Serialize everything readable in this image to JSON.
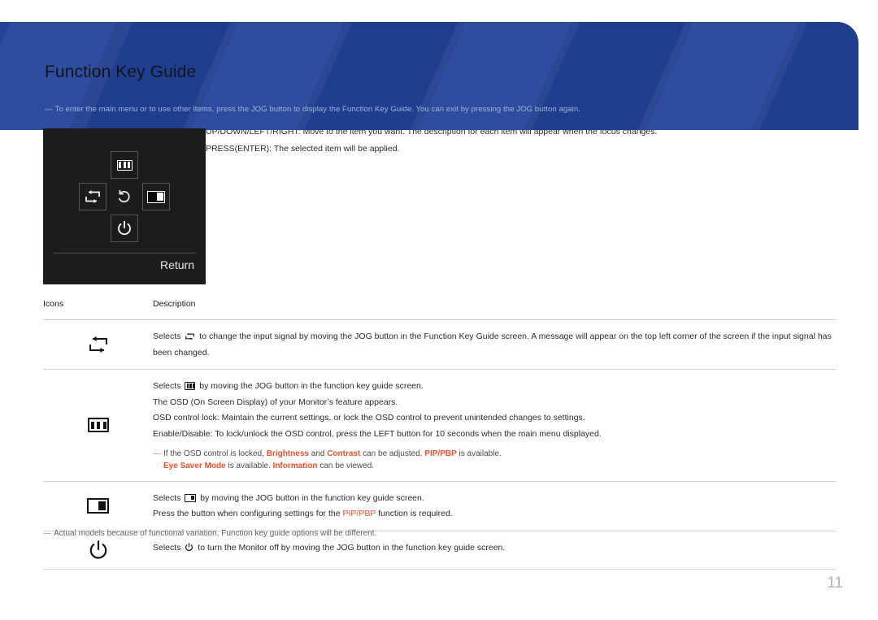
{
  "header": {
    "title": "Function Key Guide",
    "note_dash": "—",
    "note": "To enter the main menu or to use other items, press the JOG button to display the Function Key Guide. You can exit by pressing the JOG button again.",
    "background_color": "#23439b"
  },
  "intro": {
    "line1": "UP/DOWN/LEFT/RIGHT: Move to the item you want. The description for each item will appear when the focus changes.",
    "line2": "PRESS(ENTER): The selected item will be applied."
  },
  "osd": {
    "return_label": "Return",
    "buttons": {
      "up": "menu-icon",
      "left": "source-icon",
      "center": "back-icon",
      "right": "pip-pbp-icon",
      "down": "power-icon"
    }
  },
  "table": {
    "headers": {
      "icons": "Icons",
      "description": "Description"
    },
    "rows": [
      {
        "icon": "source-icon",
        "lines": [
          "Selects   to change the input signal by moving the JOG button in the Function Key Guide screen. A message will appear on the top left corner of the screen if the input signal has been changed."
        ],
        "text_before_icon": "Selects",
        "text_after_icon": "to change the input signal by moving the JOG button in the Function Key Guide screen. A message will appear on the top left corner of the screen if the input signal has been changed."
      },
      {
        "icon": "menu-icon",
        "text_before_icon": "Selects",
        "text_after_icon": "by moving the JOG button in the function key guide screen.",
        "line2": "The OSD (On Screen Display) of your Monitor’s feature appears.",
        "line3": "OSD control lock: Maintain the current settings, or lock the OSD control to prevent unintended changes to settings.",
        "line4": "Enable/Disable: To lock/unlock the OSD control, press the LEFT button for 10 seconds when the main menu displayed.",
        "note_dash": "—",
        "note_a_1": "If the OSD control is locked,",
        "note_a_hl1": "Brightness",
        "note_a_2": "and",
        "note_a_hl2": "Contrast",
        "note_a_3": "can be adjusted.",
        "note_a_hl3": "PIP/PBP",
        "note_a_4": "is available.",
        "note_b_hl1": "Eye Saver Mode",
        "note_b_1": "is available.",
        "note_b_hl2": "Information",
        "note_b_2": "can be viewed."
      },
      {
        "icon": "pip-pbp-icon",
        "text_before_icon": "Selects",
        "text_after_icon": "by moving the JOG button in the function key guide screen.",
        "line2_a": "Press the button when configuring settings for the",
        "line2_hl": "PIP/PBP",
        "line2_b": "function is required."
      },
      {
        "icon": "power-icon",
        "text_before_icon": "Selects",
        "text_after_icon": "to turn the Monitor off by moving the JOG button in the function key guide screen."
      }
    ]
  },
  "footnote": {
    "dash": "—",
    "text": "Actual models because of functional variation, Function key guide options will be different."
  },
  "page_number": "11",
  "colors": {
    "accent_blue": "#23439b",
    "highlight_orange": "#e8512a",
    "page_number_gray": "#b3b3b3"
  }
}
